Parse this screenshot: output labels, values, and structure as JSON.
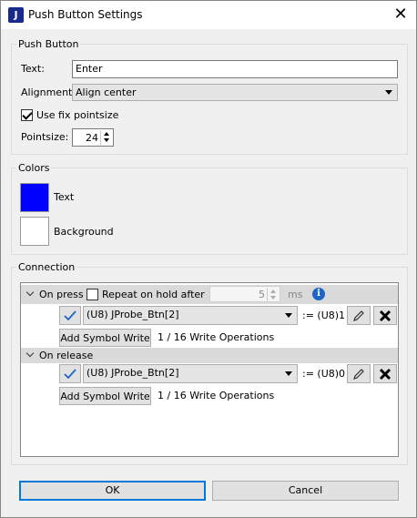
{
  "window": {
    "title": "Push Button Settings",
    "app_icon": "J"
  },
  "push_button": {
    "group_label": "Push Button",
    "text_label": "Text:",
    "text_value": "Enter",
    "alignment_label": "Alignment:",
    "alignment_value": "Align center",
    "fix_pointsize_label": "Use fix pointsize",
    "fix_pointsize_checked": true,
    "pointsize_label": "Pointsize:",
    "pointsize_value": "24"
  },
  "colors": {
    "group_label": "Colors",
    "text_label": "Text",
    "text_color": "#0000ff",
    "background_label": "Background",
    "background_color": "#ffffff"
  },
  "connection": {
    "group_label": "Connection",
    "on_press": {
      "label": "On press",
      "repeat_label": "Repeat on hold after",
      "repeat_checked": false,
      "repeat_value": "5",
      "repeat_unit": "ms",
      "symbol": "(U8) JProbe_Btn[2]",
      "assign": ":= (U8)1",
      "add_label": "Add Symbol Write",
      "ops_text": "1 / 16 Write Operations"
    },
    "on_release": {
      "label": "On release",
      "symbol": "(U8) JProbe_Btn[2]",
      "assign": ":= (U8)0",
      "add_label": "Add Symbol Write",
      "ops_text": "1 / 16 Write Operations"
    }
  },
  "buttons": {
    "ok": "OK",
    "cancel": "Cancel"
  }
}
